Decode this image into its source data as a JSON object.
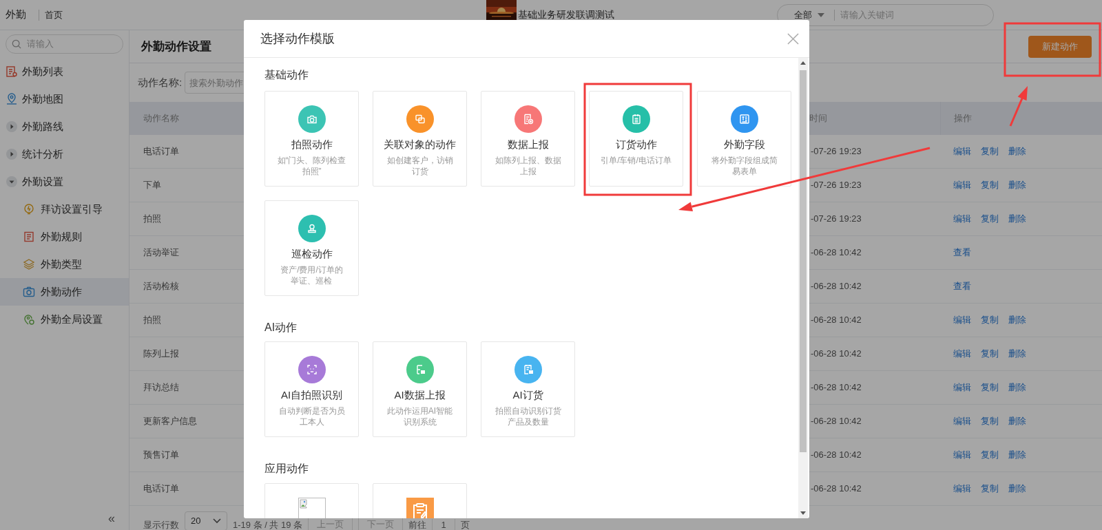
{
  "top_bar": {
    "app_name": "外勤",
    "breadcrumb": "首页",
    "title": "基础业务研发联调测试",
    "search": {
      "scope": "全部",
      "placeholder": "请输入关键词"
    }
  },
  "sidebar": {
    "search_placeholder": "请输入",
    "collapse": "«",
    "items": [
      {
        "label": "外勤列表",
        "kind": "link",
        "selected": false
      },
      {
        "label": "外勤地图",
        "kind": "link",
        "selected": false
      },
      {
        "label": "外勤路线",
        "kind": "group",
        "expanded": false,
        "selected": false
      },
      {
        "label": "统计分析",
        "kind": "group",
        "expanded": false,
        "selected": false
      },
      {
        "label": "外勤设置",
        "kind": "group",
        "expanded": true,
        "selected": false,
        "children": [
          {
            "label": "拜访设置引导",
            "selected": false
          },
          {
            "label": "外勤规则",
            "selected": false
          },
          {
            "label": "外勤类型",
            "selected": false
          },
          {
            "label": "外勤动作",
            "selected": true
          },
          {
            "label": "外勤全局设置",
            "selected": false
          }
        ]
      }
    ]
  },
  "page_title": "外勤动作设置",
  "new_button": "新建动作",
  "filter": {
    "label": "动作名称:",
    "placeholder": "搜索外勤动作"
  },
  "table": {
    "columns": [
      "动作名称",
      "时间",
      "操作"
    ],
    "rows": [
      {
        "name": "电话订单",
        "time": "-07-26 19:23",
        "actions": [
          "编辑",
          "复制",
          "删除"
        ]
      },
      {
        "name": "下单",
        "time": "-07-26 19:23",
        "actions": [
          "编辑",
          "复制",
          "删除"
        ]
      },
      {
        "name": "拍照",
        "time": "-07-26 19:23",
        "actions": [
          "编辑",
          "复制",
          "删除"
        ]
      },
      {
        "name": "活动举证",
        "time": "-06-28 10:42",
        "actions": [
          "查看"
        ]
      },
      {
        "name": "活动检核",
        "time": "-06-28 10:42",
        "actions": [
          "查看"
        ]
      },
      {
        "name": "拍照",
        "time": "-06-28 10:42",
        "actions": [
          "编辑",
          "复制",
          "删除"
        ]
      },
      {
        "name": "陈列上报",
        "time": "-06-28 10:42",
        "actions": [
          "编辑",
          "复制",
          "删除"
        ]
      },
      {
        "name": "拜访总结",
        "time": "-06-28 10:42",
        "actions": [
          "编辑",
          "复制",
          "删除"
        ]
      },
      {
        "name": "更新客户信息",
        "time": "-06-28 10:42",
        "actions": [
          "编辑",
          "复制",
          "删除"
        ]
      },
      {
        "name": "预售订单",
        "time": "-06-28 10:42",
        "actions": [
          "编辑",
          "复制",
          "删除"
        ]
      },
      {
        "name": "电话订单",
        "time": "-06-28 10:42",
        "actions": [
          "编辑",
          "复制",
          "删除"
        ]
      }
    ]
  },
  "pagination": {
    "rows_label": "显示行数",
    "page_size": "20",
    "summary": "1-19 条 / 共 19 条",
    "prev": "上一页",
    "next": "下一页",
    "goto": "前往",
    "page": "1",
    "page_unit": "页"
  },
  "modal": {
    "title": "选择动作模版",
    "sections": [
      {
        "title": "基础动作",
        "cards": [
          {
            "kind": "template",
            "title": "拍照动作",
            "description": [
              "如“门头、陈列检查",
              "拍照”"
            ]
          },
          {
            "kind": "template",
            "title": "关联对象的动作",
            "description": [
              "如创建客户，访销",
              "订货"
            ]
          },
          {
            "kind": "template",
            "title": "数据上报",
            "description": [
              "如陈列上报、数据",
              "上报"
            ]
          },
          {
            "kind": "template",
            "title": "订货动作",
            "description": [
              "引单/车销/电话订单"
            ]
          },
          {
            "kind": "template",
            "title": "外勤字段",
            "description": [
              "将外勤字段组成简",
              "易表单"
            ]
          },
          {
            "kind": "template",
            "title": "巡检动作",
            "description": [
              "资产/费用/订单的",
              "举证、巡检"
            ]
          }
        ]
      },
      {
        "title": "AI动作",
        "cards": [
          {
            "kind": "template",
            "title": "AI自拍照识别",
            "description": [
              "自动判断是否为员",
              "工本人"
            ]
          },
          {
            "kind": "template",
            "title": "AI数据上报",
            "description": [
              "此动作运用AI智能",
              "识别系统"
            ]
          },
          {
            "kind": "template",
            "title": "AI订货",
            "description": [
              "拍照自动识别订货",
              "产品及数量"
            ]
          }
        ]
      },
      {
        "title": "应用动作",
        "cards": [
          {
            "kind": "broken_image"
          },
          {
            "kind": "app"
          }
        ]
      }
    ]
  }
}
